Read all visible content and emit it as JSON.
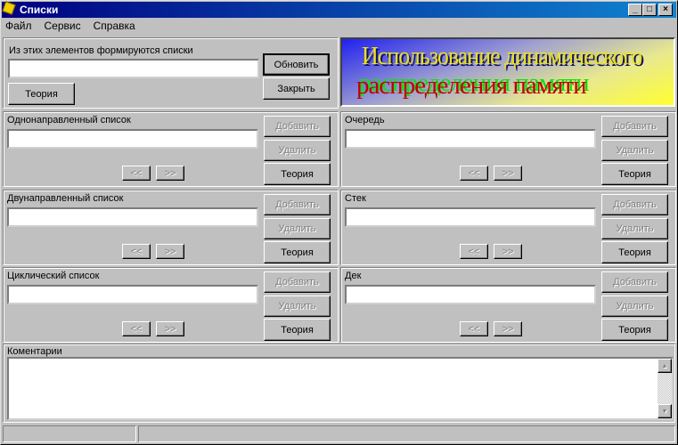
{
  "window": {
    "title": "Списки",
    "min": "_",
    "max": "□",
    "close": "×"
  },
  "menu": [
    "Файл",
    "Сервис",
    "Справка"
  ],
  "top": {
    "label": "Из этих элементов формируются списки",
    "refresh": "Обновить",
    "close": "Закрыть",
    "theory": "Теория"
  },
  "banner": {
    "line1": "Использование динамического",
    "line2": "распределения памяти"
  },
  "panels": [
    {
      "title": "Однонаправленный список",
      "add": "Добавить",
      "del": "Удалить",
      "theory": "Теория",
      "prev": "<<",
      "next": ">>"
    },
    {
      "title": "Очередь",
      "add": "Добавить",
      "del": "Удалить",
      "theory": "Теория",
      "prev": "<<",
      "next": ">>"
    },
    {
      "title": "Двунаправленный список",
      "add": "Добавить",
      "del": "Удалить",
      "theory": "Теория",
      "prev": "<<",
      "next": ">>"
    },
    {
      "title": "Стек",
      "add": "Добавить",
      "del": "Удалить",
      "theory": "Теория",
      "prev": "<<",
      "next": ">>"
    },
    {
      "title": "Циклический список",
      "add": "Добавить",
      "del": "Удалить",
      "theory": "Теория",
      "prev": "<<",
      "next": ">>"
    },
    {
      "title": "Дек",
      "add": "Добавить",
      "del": "Удалить",
      "theory": "Теория",
      "prev": "<<",
      "next": ">>"
    }
  ],
  "comments": {
    "label": "Коментарии",
    "up": "▲",
    "down": "▼"
  }
}
